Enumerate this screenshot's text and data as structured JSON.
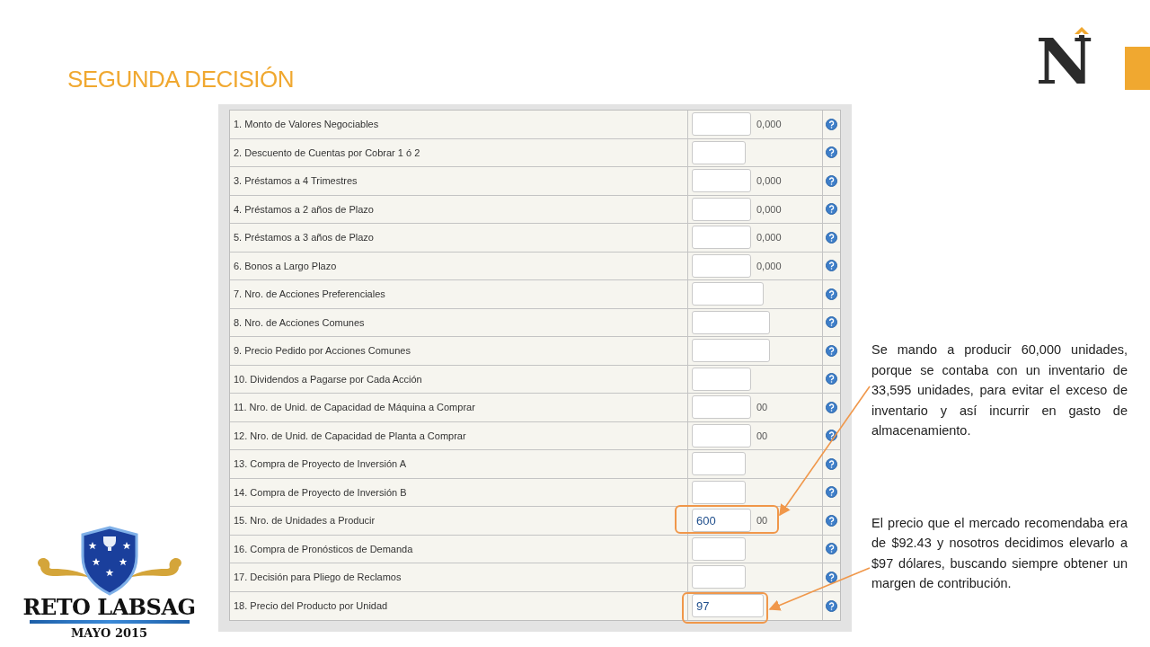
{
  "title": "SEGUNDA DECISIÓN",
  "brand_logo": {
    "letter": "N"
  },
  "event_logo": {
    "name": "RETO LABSAG",
    "date": "MAYO 2015"
  },
  "form": {
    "rows": [
      {
        "label": "1. Monto de Valores Negociables",
        "suffix": "0,000",
        "highlighted": false
      },
      {
        "label": "2. Descuento de Cuentas por Cobrar 1 ó 2",
        "highlighted": false
      },
      {
        "label": "3. Préstamos a 4 Trimestres",
        "suffix": "0,000",
        "highlighted": false
      },
      {
        "label": "4. Préstamos a 2 años de Plazo",
        "suffix": "0,000",
        "highlighted": false
      },
      {
        "label": "5. Préstamos a 3 años de Plazo",
        "suffix": "0,000",
        "highlighted": false
      },
      {
        "label": "6. Bonos a Largo Plazo",
        "suffix": "0,000",
        "highlighted": false
      },
      {
        "label": "7. Nro. de Acciones Preferenciales",
        "highlighted": false
      },
      {
        "label": "8. Nro. de Acciones Comunes",
        "highlighted": false
      },
      {
        "label": "9. Precio Pedido por Acciones Comunes",
        "highlighted": false
      },
      {
        "label": "10. Dividendos a Pagarse por Cada Acción",
        "highlighted": false
      },
      {
        "label": "11. Nro. de Unid. de Capacidad de Máquina a Comprar",
        "suffix": "00",
        "highlighted": false
      },
      {
        "label": "12. Nro. de Unid. de Capacidad de Planta a Comprar",
        "suffix": "00",
        "highlighted": false
      },
      {
        "label": "13. Compra de Proyecto de Inversión A",
        "highlighted": false
      },
      {
        "label": "14. Compra de Proyecto de Inversión B",
        "highlighted": false
      },
      {
        "label": "15. Nro. de Unidades a Producir",
        "value": "600",
        "suffix": "00",
        "highlighted": true
      },
      {
        "label": "16. Compra de Pronósticos de Demanda",
        "highlighted": false
      },
      {
        "label": "17. Decisión para Pliego de Reclamos",
        "highlighted": false
      },
      {
        "label": "18. Precio del Producto por Unidad",
        "value": "97",
        "highlighted": true
      }
    ]
  },
  "notes": [
    {
      "text": "Se mando a producir 60,000 unidades, porque se contaba con un inventario de 33,595 unidades, para evitar el exceso de inventario y así incurrir en gasto de almacenamiento."
    },
    {
      "text": "El precio que el mercado recomendaba era de $92.43 y nosotros decidimos elevarlo a $97 dólares, buscando siempre obtener un margen de contribución."
    }
  ]
}
